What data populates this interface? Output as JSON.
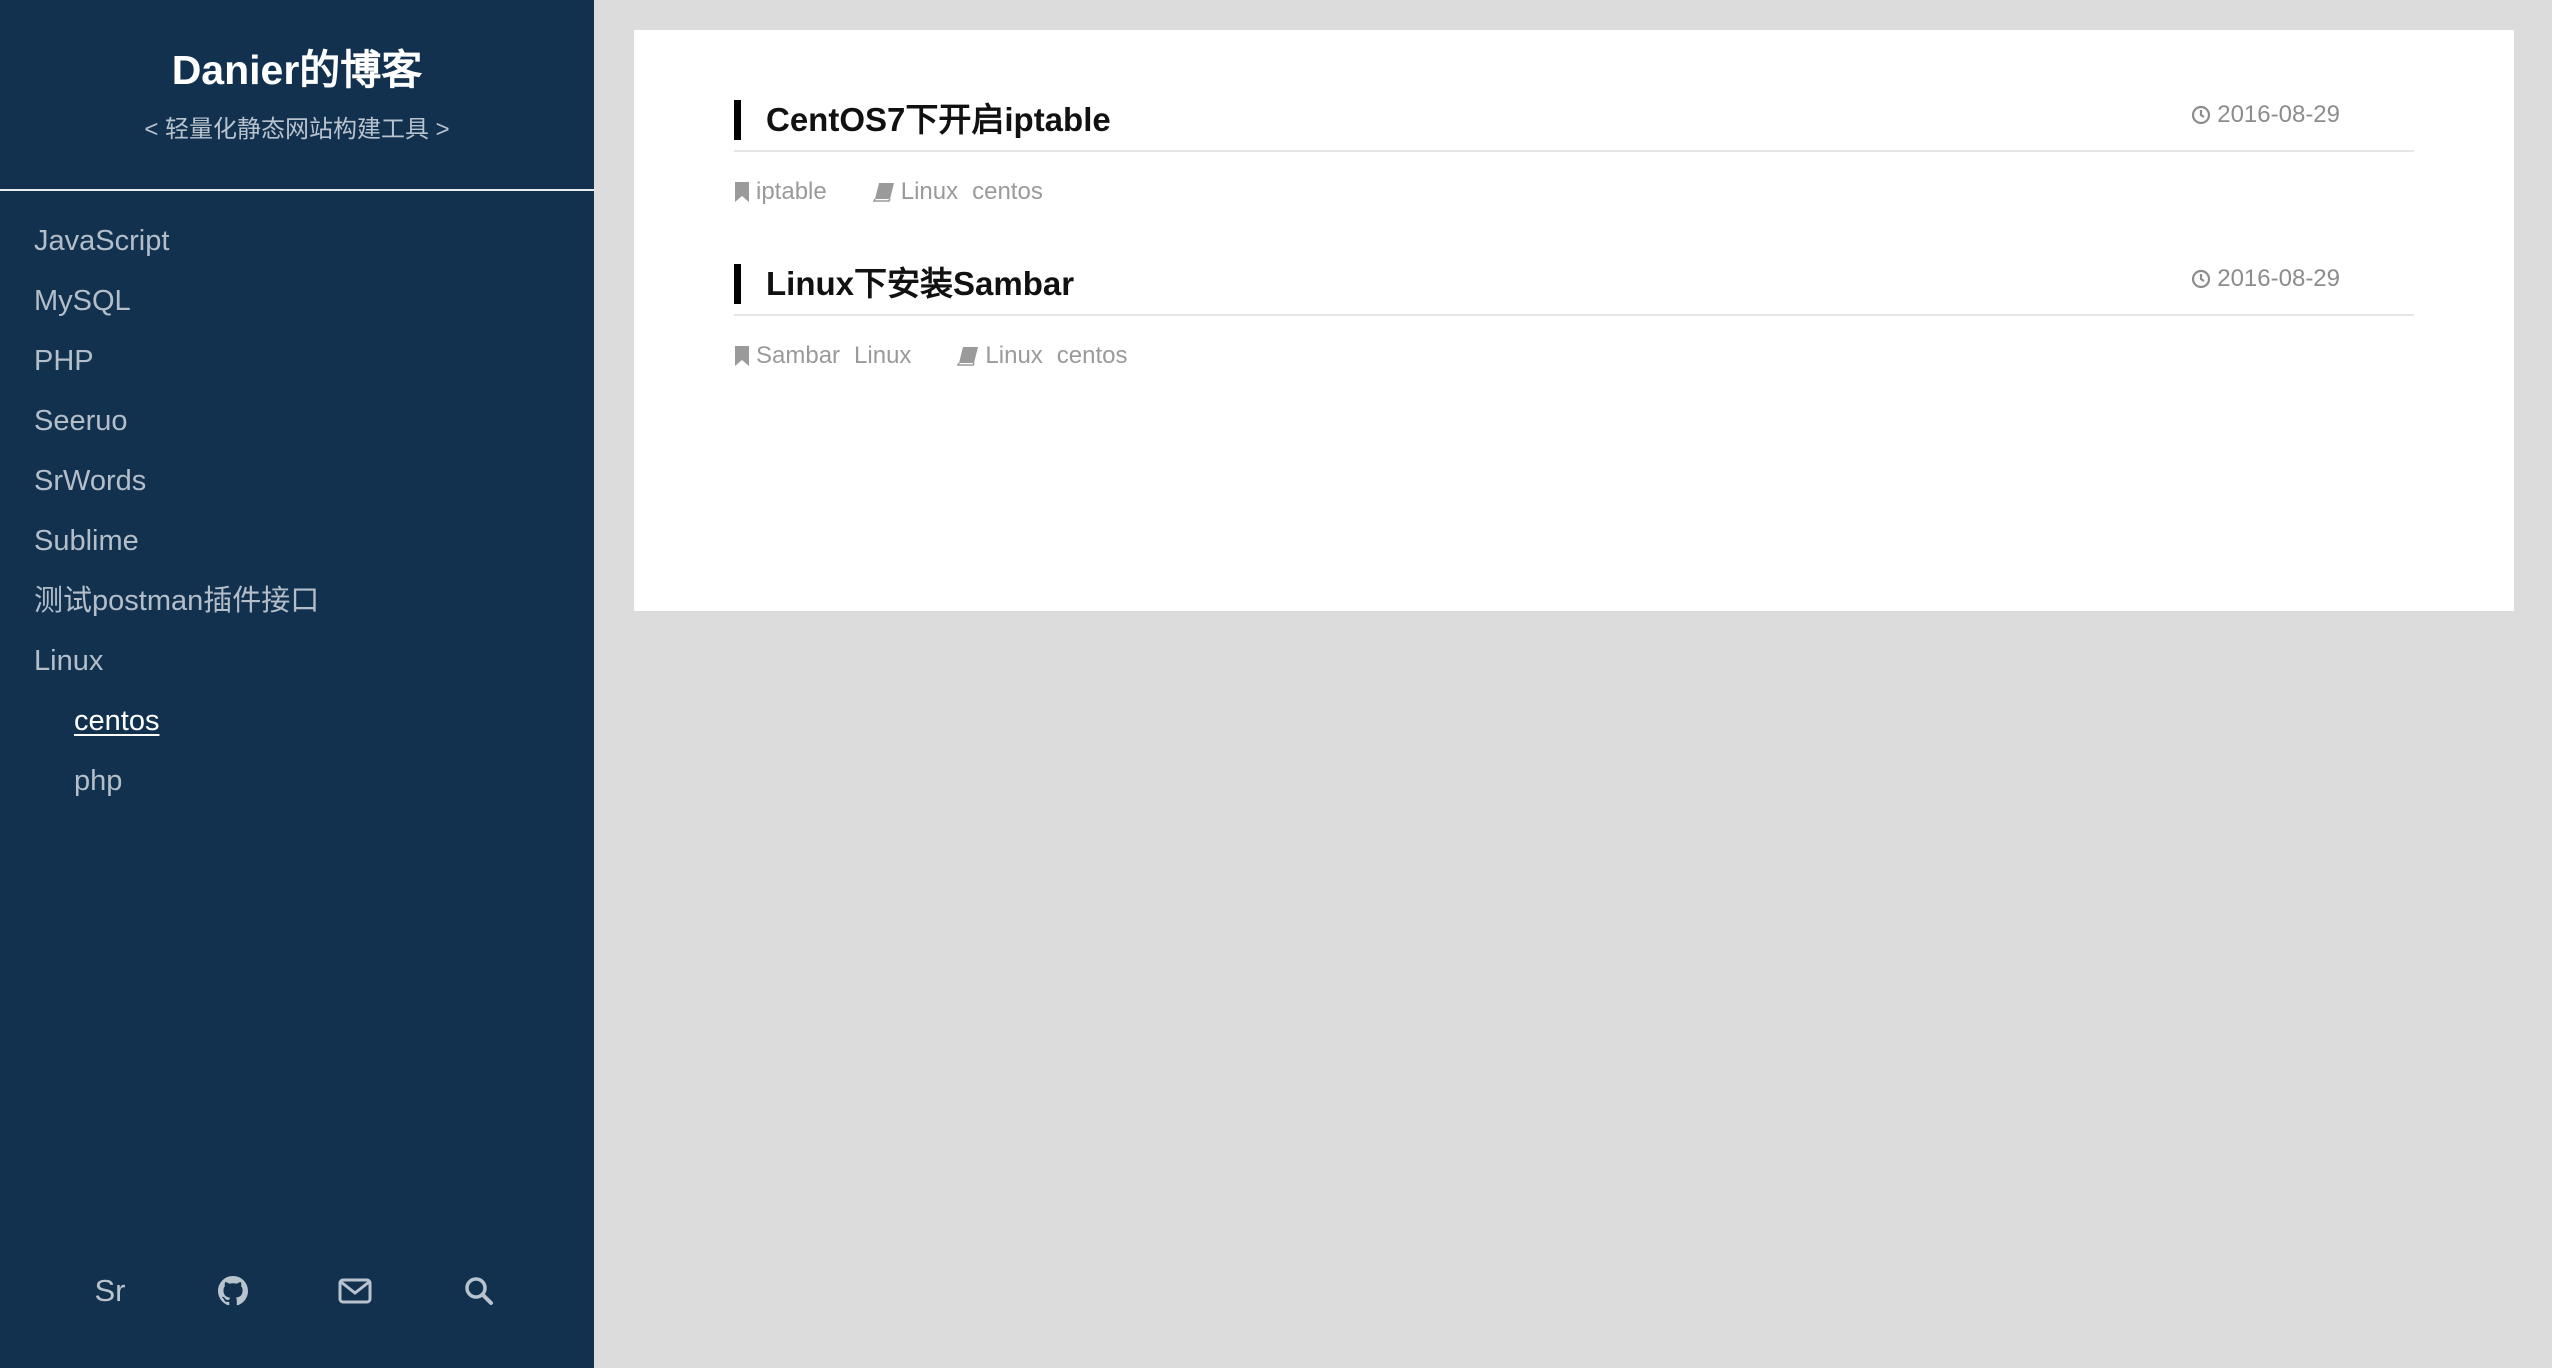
{
  "blog": {
    "title": "Danier的博客",
    "subtitle": "< 轻量化静态网站构建工具 >"
  },
  "sidebar": {
    "items": [
      {
        "label": "JavaScript"
      },
      {
        "label": "MySQL"
      },
      {
        "label": "PHP"
      },
      {
        "label": "Seeruo"
      },
      {
        "label": "SrWords"
      },
      {
        "label": "Sublime"
      },
      {
        "label": "测试postman插件接口"
      },
      {
        "label": "Linux"
      },
      {
        "label": "centos",
        "active": true
      },
      {
        "label": "php"
      }
    ],
    "footer": {
      "sr_label": "Sr",
      "icons": [
        "github-icon",
        "mail-icon",
        "search-icon"
      ]
    }
  },
  "posts": [
    {
      "title": "CentOS7下开启iptable",
      "date": "2016-08-29",
      "tags": [
        "iptable"
      ],
      "categories": [
        "Linux",
        "centos"
      ]
    },
    {
      "title": "Linux下安装Sambar",
      "date": "2016-08-29",
      "tags": [
        "Sambar",
        "Linux"
      ],
      "categories": [
        "Linux",
        "centos"
      ]
    }
  ],
  "colors": {
    "sidebar_bg": "#12314f",
    "page_bg": "#dcdcdc",
    "card_bg": "#ffffff",
    "meta_text": "#9a9a9a"
  }
}
